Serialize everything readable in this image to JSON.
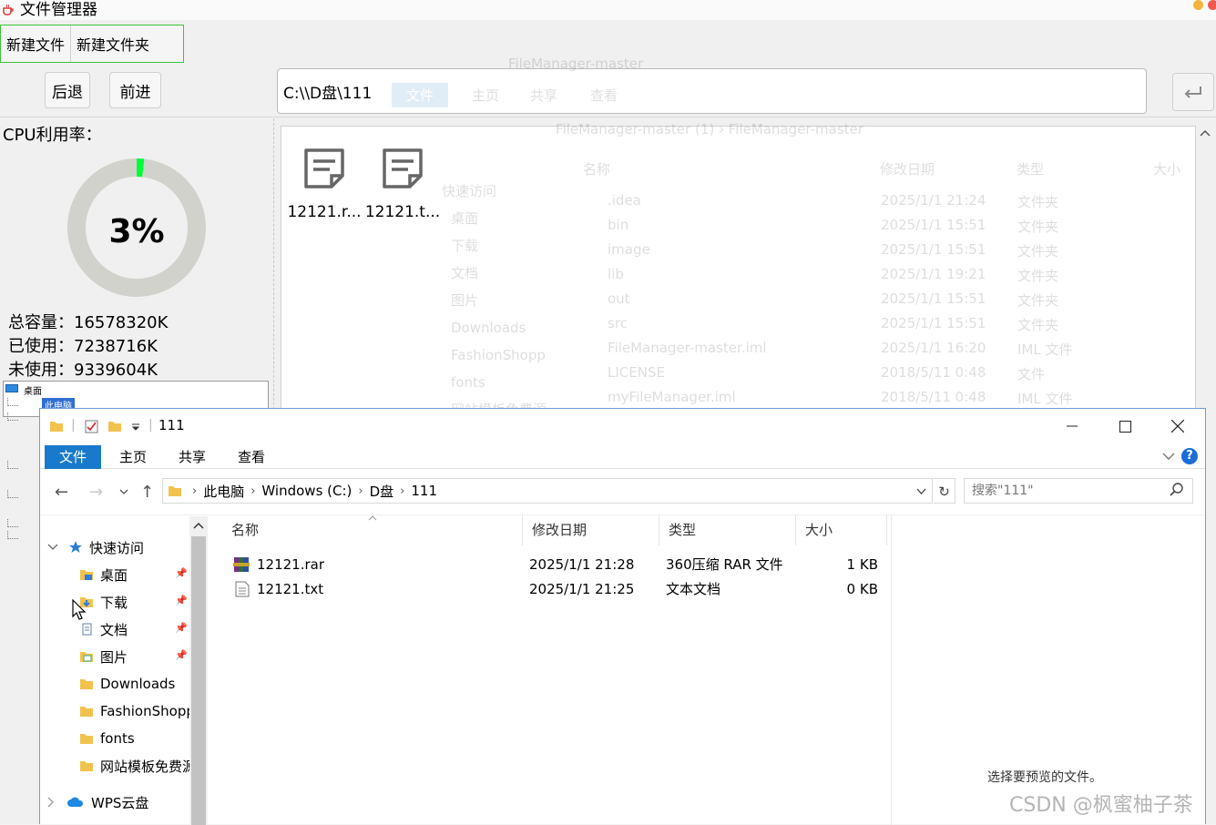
{
  "app": {
    "title": "文件管理器",
    "toolbar": {
      "new_file": "新建文件",
      "new_folder": "新建文件夹"
    },
    "nav": {
      "back": "后退",
      "forward": "前进"
    },
    "path_value": "C:\\\\D盘\\111",
    "cpu": {
      "label": "CPU利用率：",
      "percent_text": "3%",
      "percent": 3
    },
    "disk": {
      "total": "总容量：16578320K",
      "used": "已使用：7238716K",
      "free": "未使用：9339604K"
    },
    "tree": {
      "desktop": "桌面",
      "pc": "此电脑"
    },
    "files": [
      {
        "label": "12121.r..."
      },
      {
        "label": "12121.t..."
      }
    ],
    "colors": {
      "gauge_fill": "#00ff33",
      "gauge_track": "#d2d2cd",
      "toolbar_border": "#3cc43c"
    }
  },
  "ghost": {
    "title": "FileManager-master",
    "tabs": [
      "文件",
      "主页",
      "共享",
      "查看"
    ],
    "breadcrumb": "FileManager-master (1)  ›  FileManager-master",
    "headers": [
      "名称",
      "修改日期",
      "类型",
      "大小"
    ],
    "quick_access": [
      "快速访问",
      "桌面",
      "下载",
      "文档",
      "图片",
      "Downloads",
      "FashionShopp",
      "fonts",
      "网站模板免费源"
    ],
    "rows": [
      {
        "name": ".idea",
        "date": "2025/1/1 21:24",
        "type": "文件夹"
      },
      {
        "name": "bin",
        "date": "2025/1/1 15:51",
        "type": "文件夹"
      },
      {
        "name": "image",
        "date": "2025/1/1 15:51",
        "type": "文件夹"
      },
      {
        "name": "lib",
        "date": "2025/1/1 19:21",
        "type": "文件夹"
      },
      {
        "name": "out",
        "date": "2025/1/1 15:51",
        "type": "文件夹"
      },
      {
        "name": "src",
        "date": "2025/1/1 15:51",
        "type": "文件夹"
      },
      {
        "name": "FileManager-master.iml",
        "date": "2025/1/1 16:20",
        "type": "IML 文件"
      },
      {
        "name": "LICENSE",
        "date": "2018/5/11 0:48",
        "type": "文件"
      },
      {
        "name": "myFileManager.iml",
        "date": "2018/5/11 0:48",
        "type": "IML 文件"
      }
    ]
  },
  "explorer": {
    "title": "111",
    "tabs": {
      "file": "文件",
      "home": "主页",
      "share": "共享",
      "view": "查看"
    },
    "breadcrumb": [
      "此电脑",
      "Windows (C:)",
      "D盘",
      "111"
    ],
    "search_placeholder": "搜索\"111\"",
    "nav": {
      "quick_access": "快速访问",
      "desktop": "桌面",
      "downloads_cn": "下载",
      "documents": "文档",
      "pictures": "图片",
      "downloads": "Downloads",
      "fashion": "FashionShopp",
      "fonts": "fonts",
      "templates": "网站模板免费源",
      "wps": "WPS云盘"
    },
    "columns": {
      "name": "名称",
      "date": "修改日期",
      "type": "类型",
      "size": "大小"
    },
    "rows": [
      {
        "name": "12121.rar",
        "date": "2025/1/1 21:28",
        "type": "360压缩 RAR 文件",
        "size": "1 KB"
      },
      {
        "name": "12121.txt",
        "date": "2025/1/1 21:25",
        "type": "文本文档",
        "size": "0 KB"
      }
    ],
    "preview": "选择要预览的文件。",
    "colors": {
      "accent": "#1979ca",
      "border": "#6b9fd6"
    }
  },
  "watermark": "CSDN @枫蜜柚子茶"
}
